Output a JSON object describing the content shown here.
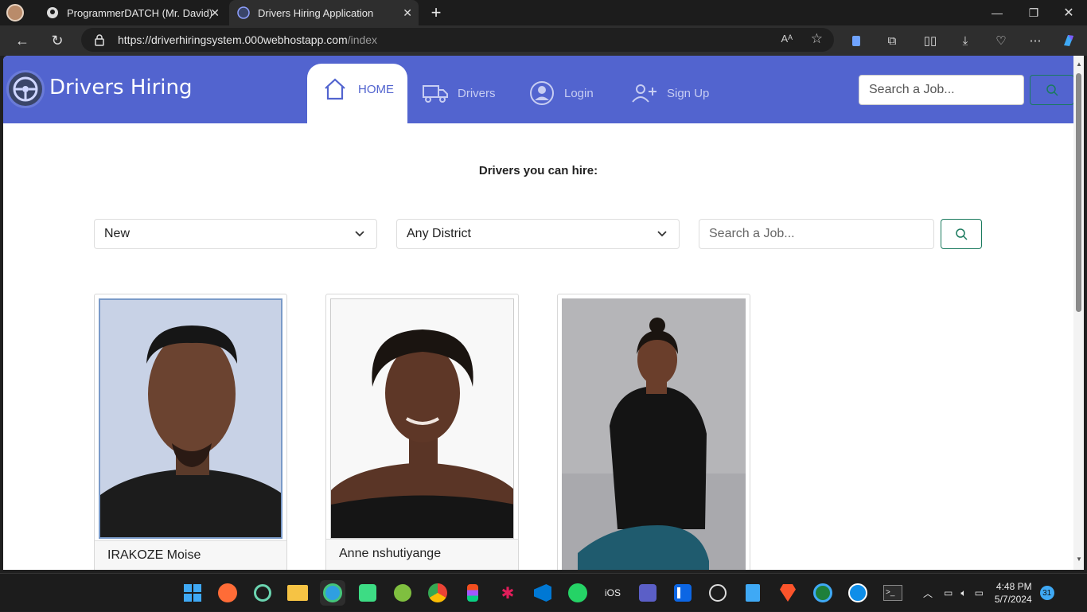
{
  "browser": {
    "tabs": [
      {
        "title": "ProgrammerDATCH (Mr. David)",
        "active": false
      },
      {
        "title": "Drivers Hiring Application",
        "active": true
      }
    ],
    "url_main": "https://driverhiringsystem.000webhostapp.com",
    "url_path": "/index"
  },
  "site": {
    "brand": "Drivers Hiring",
    "nav": {
      "home": "HOME",
      "drivers": "Drivers",
      "login": "Login",
      "signup": "Sign Up"
    },
    "header_search_placeholder": "Search a Job..."
  },
  "main": {
    "title": "Drivers you can hire:",
    "filter_status": "New",
    "filter_district": "Any District",
    "search_placeholder": "Search a Job..."
  },
  "drivers": [
    {
      "name": "IRAKOZE Moise"
    },
    {
      "name": "Anne nshutiyange"
    },
    {
      "name": ""
    }
  ],
  "taskbar": {
    "time": "4:48 PM",
    "date": "5/7/2024",
    "notification_count": "31",
    "ios_label": "iOS"
  },
  "colors": {
    "header": "#5264cf",
    "accent_green": "#1a7a5e"
  }
}
